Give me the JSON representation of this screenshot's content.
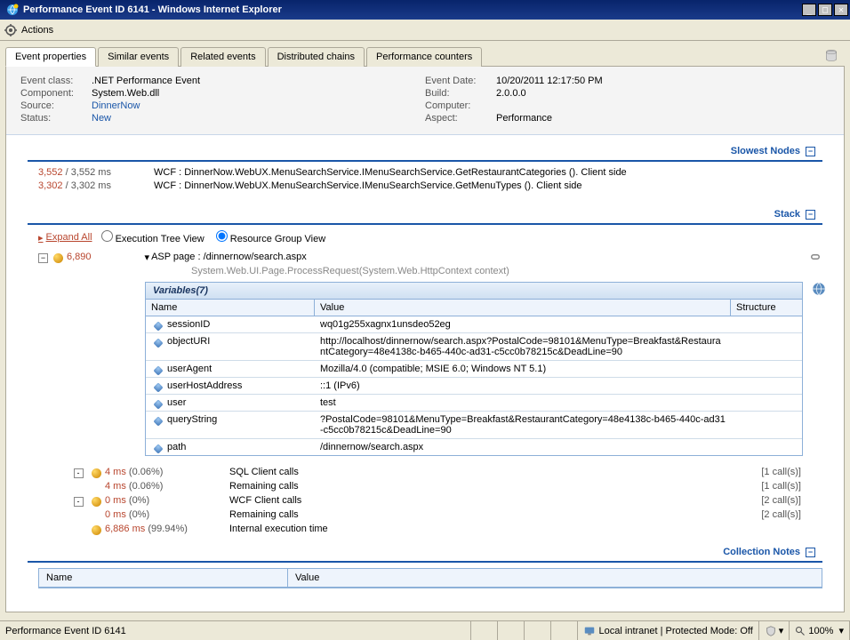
{
  "title": "Performance Event ID 6141 - Windows Internet Explorer",
  "menu": {
    "actions": "Actions"
  },
  "tabs": [
    "Event properties",
    "Similar events",
    "Related events",
    "Distributed chains",
    "Performance counters"
  ],
  "info": {
    "left": [
      {
        "label": "Event class:",
        "value": ".NET Performance Event",
        "link": false
      },
      {
        "label": "Component:",
        "value": "System.Web.dll",
        "link": false
      },
      {
        "label": "Source:",
        "value": "DinnerNow",
        "link": true
      },
      {
        "label": "Status:",
        "value": "New",
        "link": true
      }
    ],
    "right": [
      {
        "label": "Event Date:",
        "value": "10/20/2011 12:17:50 PM"
      },
      {
        "label": "Build:",
        "value": "2.0.0.0"
      },
      {
        "label": "Computer:",
        "value": ""
      },
      {
        "label": "Aspect:",
        "value": "Performance"
      }
    ]
  },
  "sections": {
    "slowest": "Slowest Nodes",
    "stack": "Stack",
    "collection": "Collection Notes"
  },
  "slowNodes": [
    {
      "t1": "3,552",
      "t2": "/ 3,552 ms",
      "desc": "WCF : DinnerNow.WebUX.MenuSearchService.IMenuSearchService.GetRestaurantCategories (). Client side"
    },
    {
      "t1": "3,302",
      "t2": "/ 3,302 ms",
      "desc": "WCF : DinnerNow.WebUX.MenuSearchService.IMenuSearchService.GetMenuTypes (). Client side"
    }
  ],
  "expandAll": "Expand All",
  "views": {
    "tree": "Execution Tree View",
    "resource": "Resource Group View"
  },
  "tree": {
    "rootMs": "6,890",
    "rootTitle": "ASP page : /dinnernow/search.aspx",
    "rootSub": "System.Web.UI.Page.ProcessRequest(System.Web.HttpContext context)"
  },
  "variables": {
    "title": "Variables(7)",
    "headers": {
      "name": "Name",
      "value": "Value",
      "structure": "Structure"
    },
    "rows": [
      {
        "name": "sessionID",
        "value": "wq01g255xagnx1unsdeo52eg"
      },
      {
        "name": "objectURI",
        "value": "http://localhost/dinnernow/search.aspx?PostalCode=98101&MenuType=Breakfast&RestaurantCategory=48e4138c-b465-440c-ad31-c5cc0b78215c&DeadLine=90"
      },
      {
        "name": "userAgent",
        "value": "Mozilla/4.0 (compatible; MSIE 6.0; Windows NT 5.1)"
      },
      {
        "name": "userHostAddress",
        "value": "::1 (IPv6)"
      },
      {
        "name": "user",
        "value": "test"
      },
      {
        "name": "queryString",
        "value": "?PostalCode=98101&MenuType=Breakfast&RestaurantCategory=48e4138c-b465-440c-ad31-c5cc0b78215c&DeadLine=90"
      },
      {
        "name": "path",
        "value": "/dinnernow/search.aspx"
      }
    ]
  },
  "calls": [
    {
      "toggle": "-",
      "bullet": true,
      "ms": "4 ms",
      "pct": "(0.06%)",
      "name": "SQL Client calls",
      "count": "[1 call(s)]"
    },
    {
      "toggle": "",
      "bullet": false,
      "ms": "4 ms",
      "pct": "(0.06%)",
      "name": "Remaining calls",
      "count": "[1 call(s)]"
    },
    {
      "toggle": "-",
      "bullet": true,
      "ms": "0 ms",
      "pct": "(0%)",
      "name": "WCF Client calls",
      "count": "[2 call(s)]"
    },
    {
      "toggle": "",
      "bullet": false,
      "ms": "0 ms",
      "pct": "(0%)",
      "name": "Remaining calls",
      "count": "[2 call(s)]"
    },
    {
      "toggle": "",
      "bullet": true,
      "ms": "6,886 ms",
      "pct": "(99.94%)",
      "name": "Internal execution time",
      "count": ""
    }
  ],
  "notesTable": {
    "name": "Name",
    "value": "Value"
  },
  "status": {
    "left": "Performance Event ID 6141",
    "security": "Local intranet | Protected Mode: Off",
    "zoom": "100%"
  }
}
